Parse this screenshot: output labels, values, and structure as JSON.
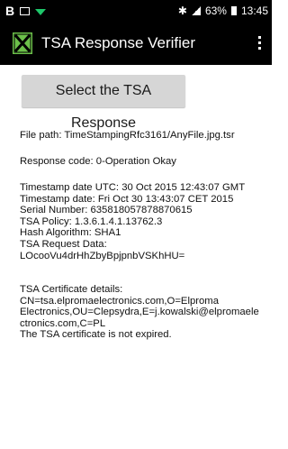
{
  "status_bar": {
    "left_icons": [
      "b-icon",
      "image-icon",
      "wifi-icon"
    ],
    "battery_percent": "63%",
    "time": "13:45"
  },
  "app": {
    "title": "TSA Response Verifier",
    "logo_color": "#6cc04a"
  },
  "select_button": {
    "label": "Select the TSA Response"
  },
  "details": {
    "file_path": "File path: TimeStampingRfc3161/AnyFile.jpg.tsr",
    "response_code": "Response code: 0-Operation Okay",
    "timestamp_utc": "Timestamp date UTC: 30 Oct 2015 12:43:07 GMT",
    "timestamp_local": "Timestamp date: Fri Oct 30 13:43:07 CET 2015",
    "serial_number": "Serial Number: 635818057878870615",
    "tsa_policy": "TSA Policy: 1.3.6.1.4.1.13762.3",
    "hash_algorithm": "Hash Algorithm: SHA1",
    "request_data_label": "TSA Request Data:",
    "request_data_value": "LOcooVu4drHhZbyBpjpnbVSKhHU=",
    "cert_label": "TSA Certificate details:",
    "cert_line1": "CN=tsa.elpromaelectronics.com,O=Elproma",
    "cert_line2": "Electronics,OU=Clepsydra,E=j.kowalski@elpromaele",
    "cert_line3": "ctronics.com,C=PL",
    "cert_status": "The TSA certificate is not expired."
  }
}
